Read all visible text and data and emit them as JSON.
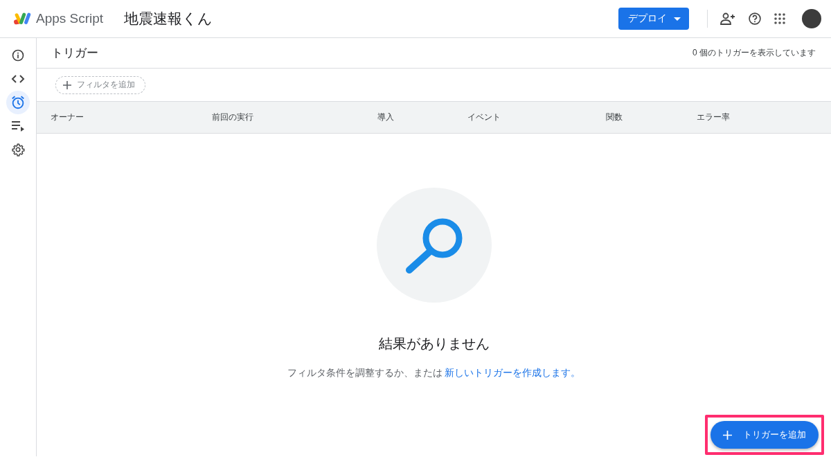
{
  "app": {
    "name": "Apps Script",
    "project_title": "地震速報くん"
  },
  "header": {
    "deploy_button": "デプロイ"
  },
  "sidebar": {
    "items": [
      {
        "kind": "info",
        "selected": false
      },
      {
        "kind": "code",
        "selected": false
      },
      {
        "kind": "alarm",
        "selected": true
      },
      {
        "kind": "executions",
        "selected": false
      },
      {
        "kind": "settings",
        "selected": false
      }
    ]
  },
  "page": {
    "title": "トリガー",
    "count_text": "0 個のトリガーを表示しています"
  },
  "filter": {
    "label": "フィルタを追加"
  },
  "table": {
    "columns": [
      "オーナー",
      "前回の実行",
      "導入",
      "イベント",
      "関数",
      "エラー率"
    ]
  },
  "empty_state": {
    "title": "結果がありません",
    "message": "フィルタ条件を調整するか、または ",
    "link": "新しいトリガーを作成します。"
  },
  "fab": {
    "label": "トリガーを追加",
    "highlighted": true
  }
}
